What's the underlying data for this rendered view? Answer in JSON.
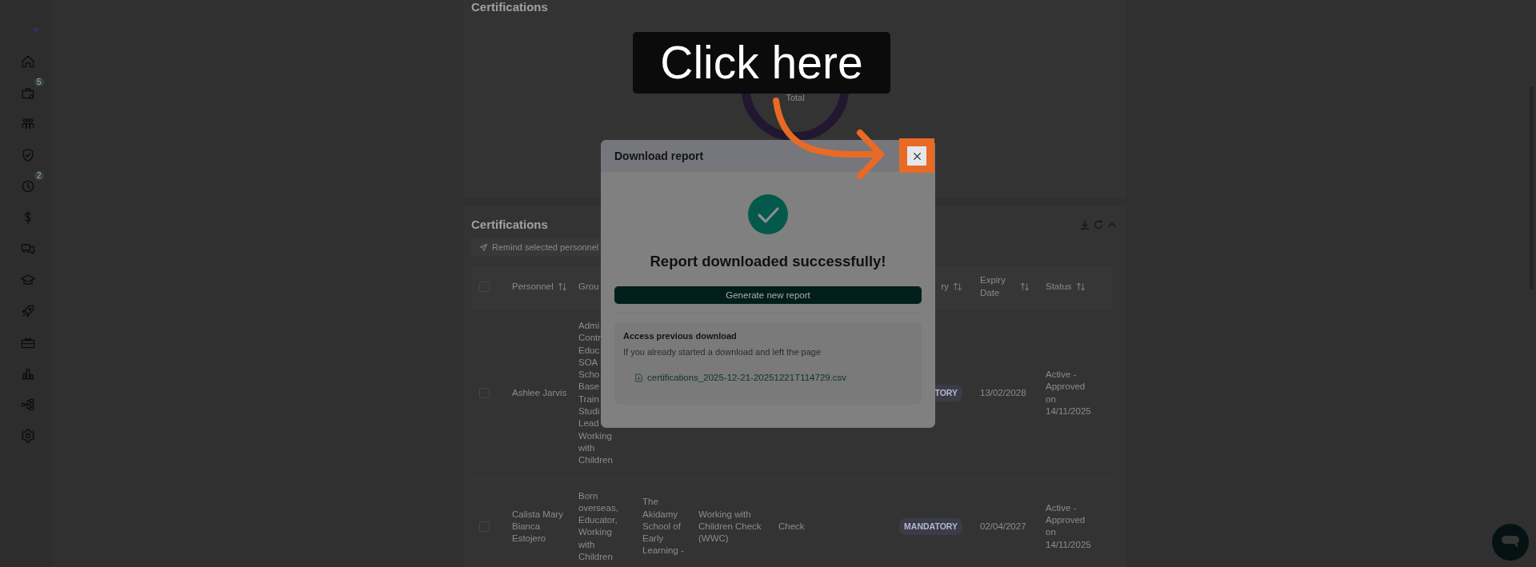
{
  "sidebar": {
    "items": [
      {
        "kind": "home"
      },
      {
        "kind": "bag",
        "badge": "5"
      },
      {
        "kind": "team"
      },
      {
        "kind": "shield"
      },
      {
        "kind": "clock",
        "badge": "2"
      },
      {
        "kind": "dollar"
      },
      {
        "kind": "chat"
      },
      {
        "kind": "cap"
      },
      {
        "kind": "rocket"
      },
      {
        "kind": "gift"
      },
      {
        "kind": "chart"
      },
      {
        "kind": "tree"
      },
      {
        "kind": "gear"
      }
    ]
  },
  "summary_card": {
    "title": "Certifications",
    "donut_label": "Total"
  },
  "table_card": {
    "title": "Certifications",
    "remind_button": {
      "label": "Remind selected personnel",
      "disabled": true
    },
    "table": {
      "header_checked": false,
      "columns": {
        "personnel": {
          "label": "Personnel",
          "sortable": true
        },
        "column_3": {
          "label": "Grou",
          "sortable": false
        },
        "column_7": {
          "label": "ry",
          "sortable": true
        },
        "expiry_date": {
          "label": "Expiry Date",
          "sortable": true
        },
        "status": {
          "label": "Status",
          "sortable": true
        }
      },
      "rows": [
        {
          "selected": false,
          "personnel": "Ashlee Jarvis",
          "column_3": "Admi Contr Educ SOA Scho Base Train Studi Lead Working with Children",
          "column_7": "TORY",
          "expiry_date": "13/02/2028",
          "status": "Active - Approved on 14/11/2025"
        },
        {
          "selected": false,
          "personnel": "Calista Mary Bianca Estojero",
          "column_3": "Born overseas, Educator, Working with Children",
          "column_4": "The Akidamy School of Early Learning -",
          "column_5": "Working with Children Check (WWC)",
          "column_6": "Check",
          "column_7": "MANDATORY",
          "expiry_date": "02/04/2027",
          "status": "Active - Approved on 14/11/2025"
        }
      ]
    }
  },
  "modal": {
    "title": "Download report",
    "heading": "Report downloaded successfully!",
    "primary_button": "Generate new report",
    "previous": {
      "title": "Access previous download",
      "description": "If you already started a download and left the page",
      "file": "certifications_2025-12-21-20251221T114729.csv"
    }
  },
  "guide": {
    "callout": "Click here"
  }
}
